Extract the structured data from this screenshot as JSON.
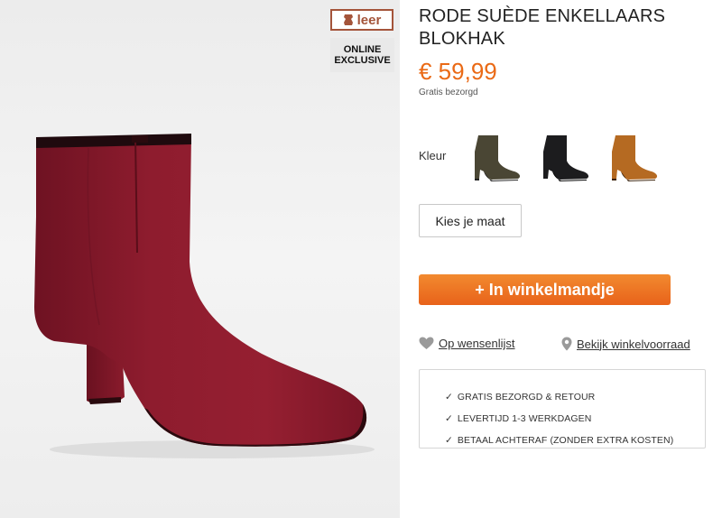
{
  "product": {
    "title": "RODE SUÈDE ENKELLAARS BLOKHAK",
    "price": "€ 59,99",
    "shipping_note": "Gratis bezorgd",
    "image_alt": ""
  },
  "badges": {
    "leather": "leer",
    "online_line1": "ONLINE",
    "online_line2": "EXCLUSIVE"
  },
  "colors": {
    "label": "Kleur",
    "swatches": [
      {
        "name": "olive-suede-boot-swatch",
        "color": "#4a4634"
      },
      {
        "name": "black-suede-boot-swatch",
        "color": "#1c1c1e"
      },
      {
        "name": "cognac-suede-boot-swatch",
        "color": "#b56a22"
      }
    ]
  },
  "actions": {
    "size_button": "Kies je maat",
    "cart_button": "+ In winkelmandje",
    "wishlist": "Op wensenlijst",
    "store_stock": "Bekijk winkelvoorraad"
  },
  "usps": [
    "GRATIS BEZORGD & RETOUR",
    "LEVERTIJD 1-3 WERKDAGEN",
    "BETAAL ACHTERAF (ZONDER EXTRA KOSTEN)"
  ],
  "colors_theme": {
    "accent": "#e8621a",
    "price": "#ea6a16",
    "boot": "#8b1a2b",
    "leather_badge": "#a4543a"
  }
}
